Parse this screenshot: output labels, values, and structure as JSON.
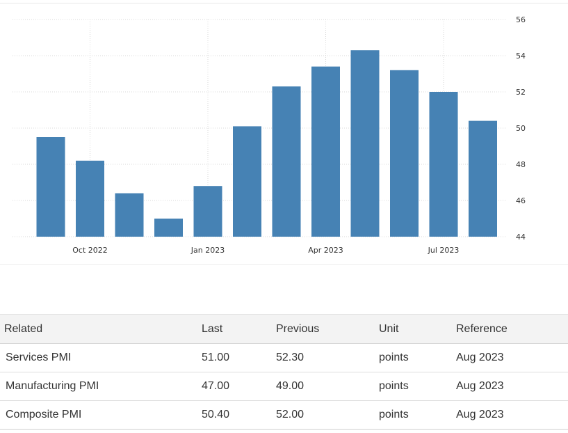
{
  "chart_data": {
    "type": "bar",
    "categories": [
      "Sep 2022",
      "Oct 2022",
      "Nov 2022",
      "Dec 2022",
      "Jan 2023",
      "Feb 2023",
      "Mar 2023",
      "Apr 2023",
      "May 2023",
      "Jun 2023",
      "Jul 2023",
      "Aug 2023"
    ],
    "values": [
      49.5,
      48.2,
      46.4,
      45.0,
      46.8,
      50.1,
      52.3,
      53.4,
      54.3,
      53.2,
      52.0,
      50.4
    ],
    "x_tick_labels": [
      {
        "category": "Oct 2022",
        "label": "Oct 2022"
      },
      {
        "category": "Jan 2023",
        "label": "Jan 2023"
      },
      {
        "category": "Apr 2023",
        "label": "Apr 2023"
      },
      {
        "category": "Jul 2023",
        "label": "Jul 2023"
      }
    ],
    "y_ticks": [
      "44",
      "46",
      "48",
      "50",
      "52",
      "54",
      "56"
    ],
    "ylim": [
      44,
      56
    ],
    "y_axis_side": "right",
    "grid": true,
    "bar_color": "#4682b4",
    "grid_color": "#d8d8d8",
    "title": "",
    "xlabel": "",
    "ylabel": ""
  },
  "related_table": {
    "headers": {
      "name": "Related",
      "last": "Last",
      "previous": "Previous",
      "unit": "Unit",
      "reference": "Reference"
    },
    "rows": [
      {
        "name": "Services PMI",
        "last": "51.00",
        "previous": "52.30",
        "unit": "points",
        "reference": "Aug 2023"
      },
      {
        "name": "Manufacturing PMI",
        "last": "47.00",
        "previous": "49.00",
        "unit": "points",
        "reference": "Aug 2023"
      },
      {
        "name": "Composite PMI",
        "last": "50.40",
        "previous": "52.00",
        "unit": "points",
        "reference": "Aug 2023"
      }
    ]
  }
}
